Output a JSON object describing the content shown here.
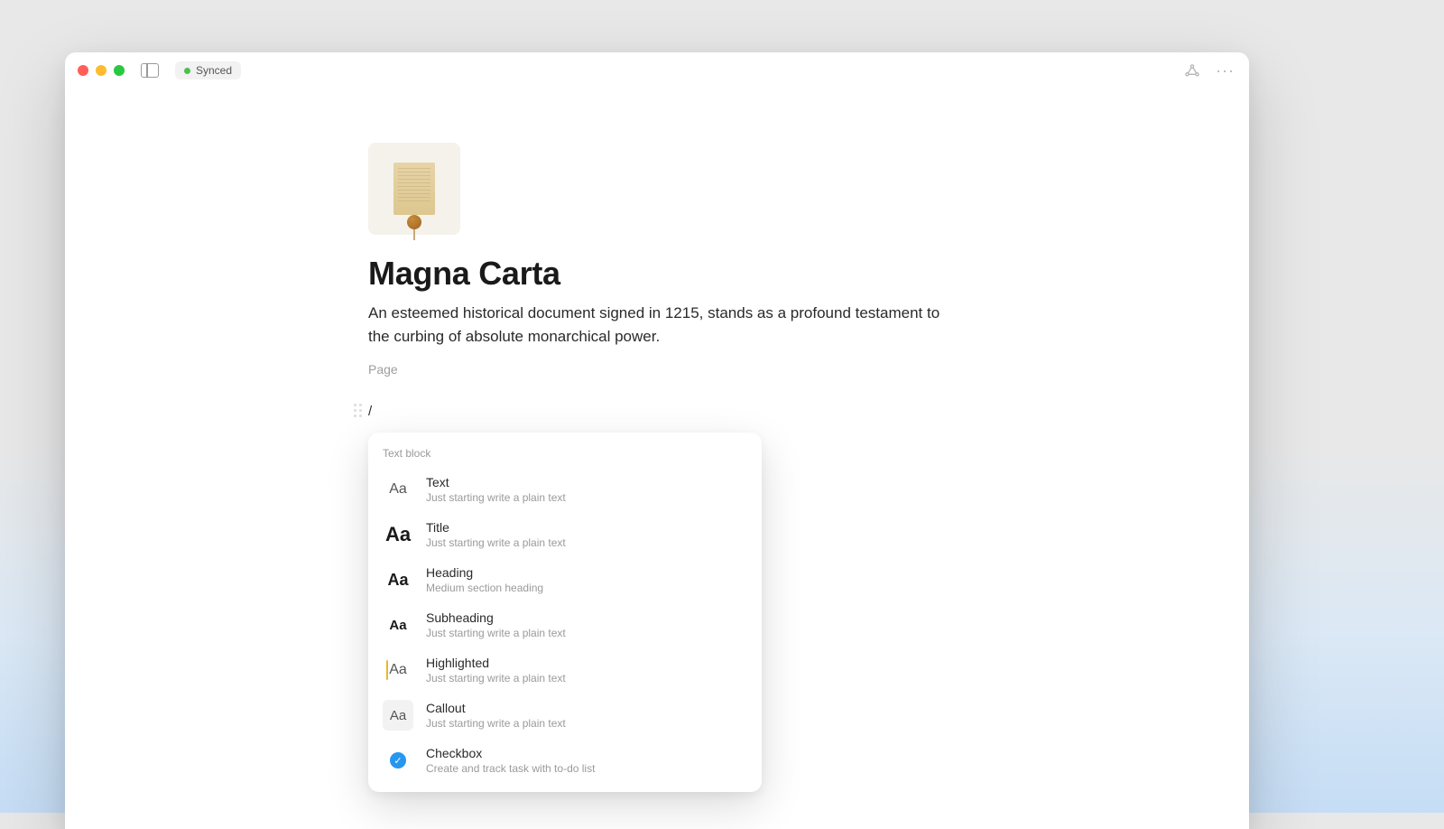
{
  "titlebar": {
    "sync_label": "Synced"
  },
  "page": {
    "title": "Magna Carta",
    "subtitle": "An esteemed historical document signed in 1215, stands as a profound testament to the curbing of absolute monarchical power.",
    "type_label": "Page",
    "slash_prompt": "/"
  },
  "popup": {
    "section_label": "Text block",
    "items": [
      {
        "icon_style": "plain",
        "icon_glyph": "Aa",
        "name": "Text",
        "desc": "Just starting write a plain text"
      },
      {
        "icon_style": "title-icon",
        "icon_glyph": "Aa",
        "name": "Title",
        "desc": "Just starting write a plain text"
      },
      {
        "icon_style": "heading-icon",
        "icon_glyph": "Aa",
        "name": "Heading",
        "desc": "Medium section heading"
      },
      {
        "icon_style": "subheading-icon",
        "icon_glyph": "Aa",
        "name": "Subheading",
        "desc": "Just starting write a plain text"
      },
      {
        "icon_style": "highlight-icon",
        "icon_glyph": "Aa",
        "name": "Highlighted",
        "desc": "Just starting write a plain text"
      },
      {
        "icon_style": "callout-icon",
        "icon_glyph": "Aa",
        "name": "Callout",
        "desc": "Just starting write a plain text"
      },
      {
        "icon_style": "checkbox-icon",
        "icon_glyph": "✓",
        "name": "Checkbox",
        "desc": "Create and track task with to-do list"
      }
    ]
  }
}
